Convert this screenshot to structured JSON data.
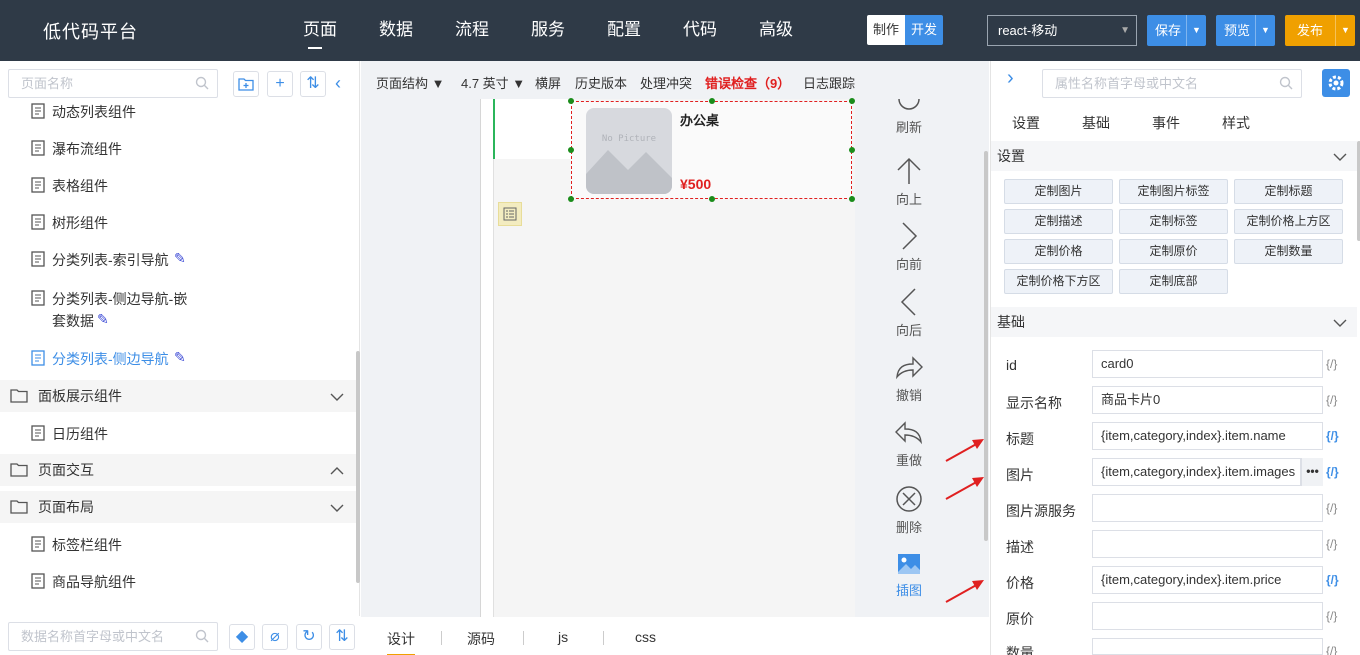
{
  "header": {
    "logo": "低代码平台",
    "nav": [
      "页面",
      "数据",
      "流程",
      "服务",
      "配置",
      "代码",
      "高级"
    ],
    "active_nav": "页面",
    "mode_make": "制作",
    "mode_dev": "开发",
    "framework": "react-移动",
    "save": "保存",
    "preview": "预览",
    "publish": "发布"
  },
  "sidebar": {
    "search_placeholder": "页面名称",
    "items": [
      {
        "label": "动态列表组件"
      },
      {
        "label": "瀑布流组件"
      },
      {
        "label": "表格组件"
      },
      {
        "label": "树形组件"
      },
      {
        "label": "分类列表-索引导航"
      },
      {
        "label": "分类列表-侧边导航-嵌"
      },
      {
        "label": "套数据"
      },
      {
        "label": "分类列表-侧边导航"
      }
    ],
    "group_panel": "面板展示组件",
    "calendar": "日历组件",
    "group_interaction": "页面交互",
    "group_layout": "页面布局",
    "tabbar": "标签栏组件",
    "goods_nav": "商品导航组件",
    "data_search_placeholder": "数据名称首字母或中文名"
  },
  "canvas_toolbar": {
    "structure": "页面结构",
    "size": "4.7 英寸",
    "landscape": "横屏",
    "history": "历史版本",
    "conflict": "处理冲突",
    "errors": "错误检查（9）",
    "log": "日志跟踪"
  },
  "card": {
    "no_picture": "No Picture",
    "title": "办公桌",
    "price": "¥500"
  },
  "actions": {
    "refresh": "刷新",
    "up": "向上",
    "forward": "向前",
    "back": "向后",
    "undo": "撤销",
    "redo": "重做",
    "delete": "删除",
    "insert": "插图"
  },
  "bottom_tabs": [
    "设计",
    "源码",
    "js",
    "css"
  ],
  "props": {
    "search_placeholder": "属性名称首字母或中文名",
    "tabs": [
      "设置",
      "基础",
      "事件",
      "样式"
    ],
    "section_settings": "设置",
    "custom_buttons": [
      "定制图片",
      "定制图片标签",
      "定制标题",
      "定制描述",
      "定制标签",
      "定制价格上方区",
      "定制价格",
      "定制原价",
      "定制数量",
      "定制价格下方区",
      "定制底部"
    ],
    "section_basic": "基础",
    "fields": [
      {
        "label": "id",
        "value": "card0"
      },
      {
        "label": "显示名称",
        "value": "商品卡片0"
      },
      {
        "label": "标题",
        "value": "{item,category,index}.item.name"
      },
      {
        "label": "图片",
        "value": "{item,category,index}.item.images"
      },
      {
        "label": "图片源服务",
        "value": ""
      },
      {
        "label": "描述",
        "value": ""
      },
      {
        "label": "价格",
        "value": "{item,category,index}.item.price"
      },
      {
        "label": "原价",
        "value": ""
      },
      {
        "label": "数量",
        "value": ""
      }
    ],
    "expr_symbol": "{/}",
    "more": "•••"
  },
  "colors": {
    "topbar": "#2f3a47",
    "accent": "#3d8ee6",
    "publish": "#f0a000",
    "error": "#e02020"
  }
}
